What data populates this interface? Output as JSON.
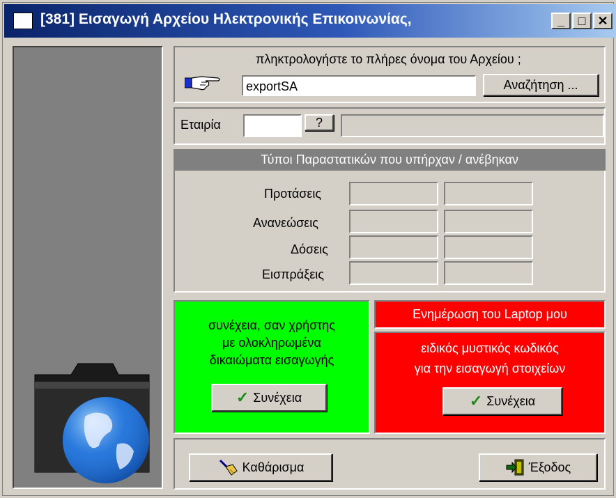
{
  "window": {
    "title": "[381]  Εισαγωγή Αρχείου Ηλεκτρονικής Επικοινωνίας,",
    "minimize": "_",
    "maximize": "□",
    "close": "✕"
  },
  "file": {
    "prompt": "πληκτρολογήστε το πλήρες όνομα του Αρχείου ;",
    "value": "exportSA",
    "browse_label": "Αναζήτηση ..."
  },
  "company": {
    "label": "Εταιρία",
    "code": "",
    "lookup_label": "?",
    "name": ""
  },
  "doc_types": {
    "header": "Τύποι Παραστατικών που υπήρχαν / ανέβηκαν",
    "rows": [
      {
        "label": "Προτάσεις",
        "existed": "",
        "uploaded": ""
      },
      {
        "label": "Ανανεώσεις",
        "existed": "",
        "uploaded": ""
      },
      {
        "label": "Δόσεις",
        "existed": "",
        "uploaded": ""
      },
      {
        "label": "Εισπράξεις",
        "existed": "",
        "uploaded": ""
      }
    ]
  },
  "green_panel": {
    "line1": "συνέχεια, σαν χρήστης",
    "line2": "με ολοκληρωμένα",
    "line3": "δικαιώματα εισαγωγής",
    "button": "Συνέχεια"
  },
  "laptop": {
    "header": "Ενημέρωση του Laptop μου",
    "line1": "ειδικός μυστικός κωδικός",
    "line2": "για την εισαγωγή στοιχείων",
    "button": "Συνέχεια"
  },
  "footer": {
    "clear_label": "Καθάρισμα",
    "exit_label": "Έξοδος"
  },
  "colors": {
    "green": "#00ff00",
    "red": "#ff0000",
    "title_start": "#0a246a",
    "title_end": "#a6caf0",
    "face": "#d4d0c8"
  },
  "icons": [
    "pointing-hand-icon",
    "globe-folder-icon",
    "checkmark-icon",
    "broom-icon",
    "exit-door-icon"
  ]
}
